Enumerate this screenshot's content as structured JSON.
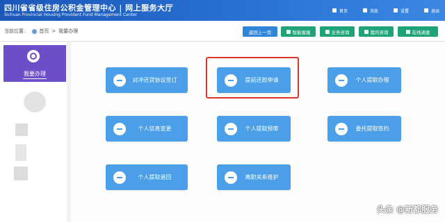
{
  "header": {
    "title": "四川省省级住房公积金管理中心 | 网上服务大厅",
    "subtitle": "Sichuan Provincial Housing Provident Fund Management Center",
    "nav": [
      {
        "label": "首页",
        "icon": "home-icon"
      },
      {
        "label": "消息",
        "icon": "message-icon"
      },
      {
        "label": "设置",
        "icon": "gear-icon"
      },
      {
        "label": "退出",
        "icon": "logout-icon"
      }
    ]
  },
  "breadcrumb": {
    "prefix": "当前位置:",
    "home": "首页",
    "sep": ">",
    "current": "我要办理"
  },
  "toolbar": {
    "back": "返回上一页",
    "smart_service": "智能客服",
    "business_consult": "业务咨询",
    "my_consult": "我的咨询",
    "online_survey": "在线调查"
  },
  "sidebar": {
    "active_label": "我要办理",
    "active_icon": "user-icon"
  },
  "cards": [
    {
      "label": "对冲还贷协议签订",
      "icon": "pen-icon"
    },
    {
      "label": "提前还款申请",
      "icon": "calendar-check-icon"
    },
    {
      "label": "个人提取办理",
      "icon": "transfer-icon"
    },
    {
      "label": "个人信息变更",
      "icon": "transfer-icon"
    },
    {
      "label": "个人提取预审",
      "icon": "transfer-icon"
    },
    {
      "label": "委托提取签约",
      "icon": "search-icon"
    },
    {
      "label": "个人提取退回",
      "icon": "transfer-icon"
    },
    {
      "label": "离职关系维护",
      "icon": "transfer-icon"
    }
  ],
  "colors": {
    "header": "#1b57b8",
    "sidebar_active": "#6c4fc8",
    "card": "#4a9fe8",
    "toolbar_blue": "#2f86d9",
    "toolbar_green": "#1fa47a",
    "highlight": "#d9362b"
  },
  "watermark": "头条 @新都服务"
}
